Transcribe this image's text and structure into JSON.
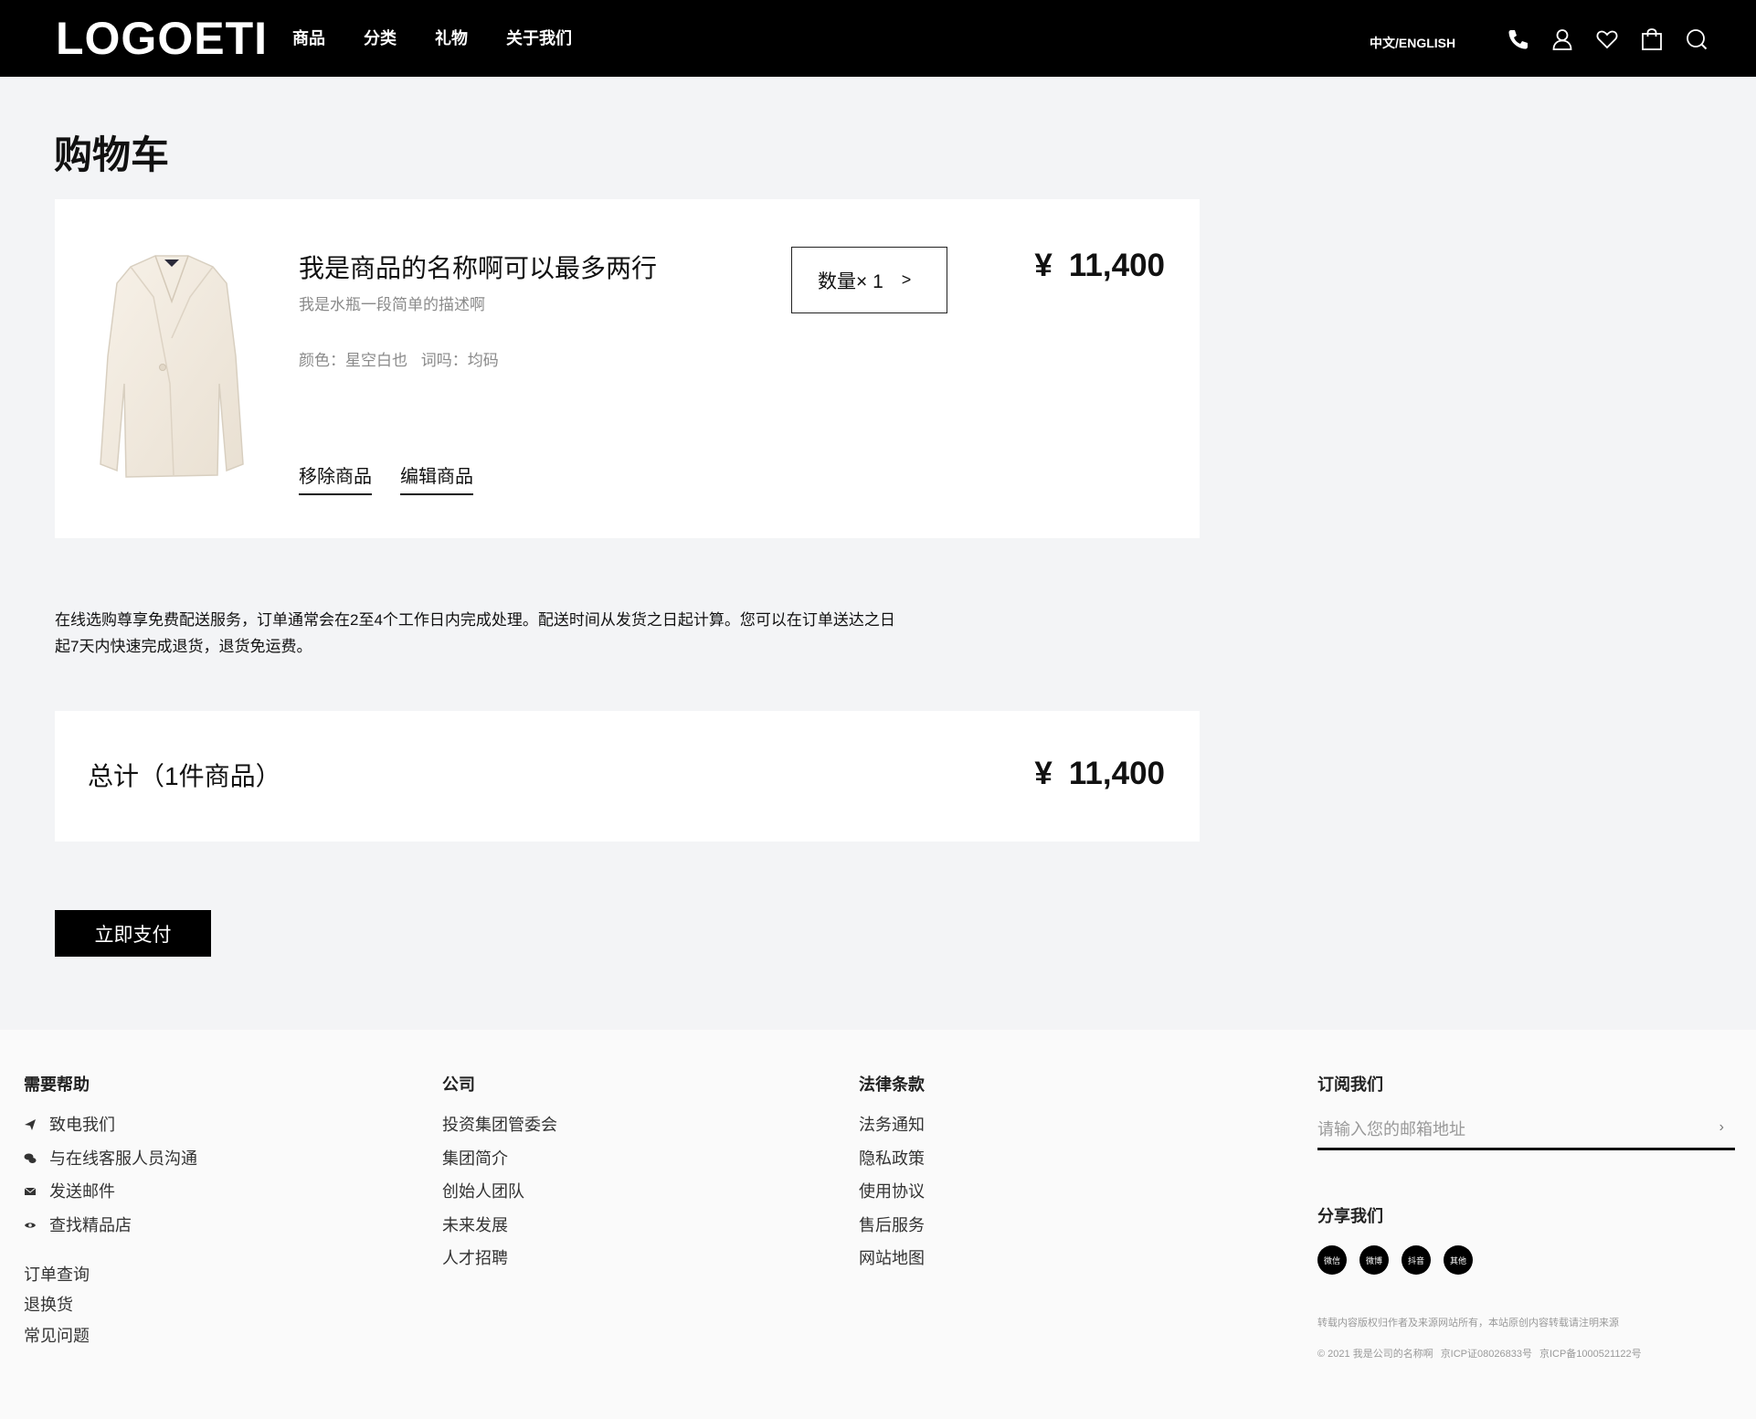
{
  "header": {
    "logo": "LOGOETI",
    "nav": [
      "商品",
      "分类",
      "礼物",
      "关于我们"
    ],
    "lang": "中文/ENGLISH",
    "icons": [
      "phone-icon",
      "user-icon",
      "heart-icon",
      "bag-icon",
      "search-icon"
    ]
  },
  "page_title": "购物车",
  "cart_item": {
    "name": "我是商品的名称啊可以最多两行",
    "description": "我是水瓶一段简单的描述啊",
    "color_label": "颜色：星空白也",
    "size_label": "词吗：均码",
    "quantity_label": "数量× 1",
    "quantity_chevron": ">",
    "currency": "¥",
    "price": "11,400",
    "remove_label": "移除商品",
    "edit_label": "编辑商品"
  },
  "notice": {
    "line1": "在线选购尊享免费配送服务，订单通常会在2至4个工作日内完成处理。配送时间从发货之日起计算。您可以在订单送达之日",
    "line2": "起7天内快速完成退货，退货免运费。"
  },
  "total": {
    "label": "总计（1件商品）",
    "currency": "¥",
    "price": "11,400"
  },
  "pay_button": "立即支付",
  "footer": {
    "help": {
      "title": "需要帮助",
      "items": [
        "致电我们",
        "与在线客服人员沟通",
        "发送邮件",
        "查找精品店"
      ],
      "extra": [
        "订单查询",
        "退换货",
        "常见问题"
      ]
    },
    "company": {
      "title": "公司",
      "items": [
        "投资集团管委会",
        "集团简介",
        "创始人团队",
        "未来发展",
        "人才招聘"
      ]
    },
    "legal": {
      "title": "法律条款",
      "items": [
        "法务通知",
        "隐私政策",
        "使用协议",
        "售后服务",
        "网站地图"
      ]
    },
    "subscribe": {
      "title": "订阅我们",
      "placeholder": "请输入您的邮箱地址",
      "arrow": "›"
    },
    "share": {
      "title": "分享我们",
      "items": [
        "微信",
        "微博",
        "抖音",
        "其他"
      ]
    },
    "copyright1": "转载内容版权归作者及来源网站所有，本站原创内容转载请注明来源",
    "copyright2_a": "© 2021 我是公司的名称啊",
    "copyright2_b": "京ICP证08026833号",
    "copyright2_c": "京ICP备1000521122号"
  }
}
